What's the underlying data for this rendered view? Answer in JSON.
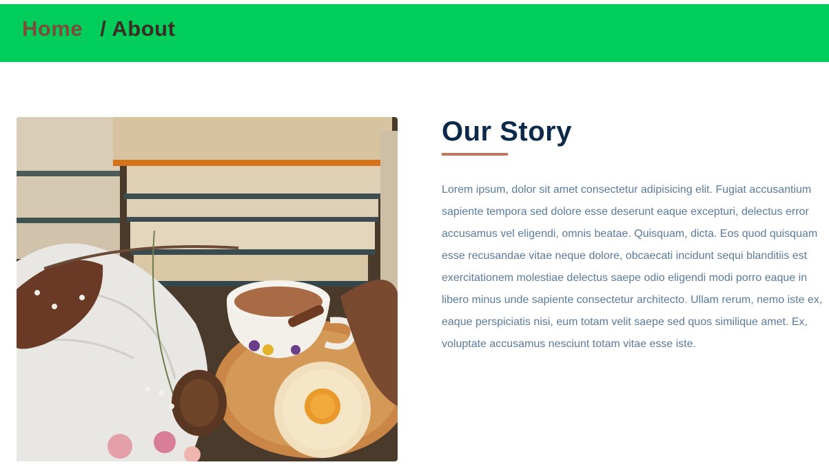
{
  "breadcrumb": {
    "home_label": "Home",
    "separator": "/",
    "current_label": "About"
  },
  "story": {
    "heading": "Our Story",
    "body": "Lorem ipsum, dolor sit amet consectetur adipisicing elit. Fugiat accusantium sapiente tempora sed dolore esse deserunt eaque excepturi, delectus error accusamus vel eligendi, omnis beatae. Quisquam, dicta. Eos quod quisquam esse recusandae vitae neque dolore, obcaecati incidunt sequi blanditiis est exercitationem molestiae delectus saepe odio eligendi modi porro eaque in libero minus unde sapiente consectetur architecto. Ullam rerum, nemo iste ex, eaque perspiciatis nisi, eum totam velit saepe sed quos similique amet. Ex, voluptate accusamus nesciunt totam vitae esse iste."
  },
  "colors": {
    "banner": "#00cd5a",
    "home_link": "#7b4f3b",
    "heading": "#0b2a4a",
    "accent_underline": "#c0775f",
    "body_text": "#5a7a9c"
  }
}
